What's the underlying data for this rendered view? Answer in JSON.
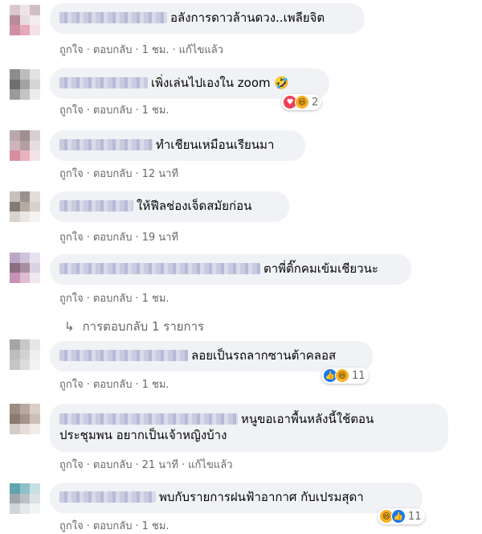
{
  "comments": [
    {
      "text": "อลังการดาวล้านดวง..เพลียจิต",
      "actions": {
        "like": "ถูกใจ",
        "reply": "ตอบกลับ",
        "time": "1 ชม.",
        "edited": "แก้ไขแล้ว"
      },
      "avatar_colors": [
        "#d9c9cf",
        "#eee4e8",
        "#cfbfc6",
        "#b88c99",
        "#e8dce1",
        "#f2ecef",
        "#cf8fa2",
        "#e6a9b9",
        "#f4e0e6"
      ]
    },
    {
      "text": "เพิ่งเล่นไปเองใน zoom 🤣",
      "actions": {
        "like": "ถูกใจ",
        "reply": "ตอบกลับ",
        "time": "1 ชม."
      },
      "reactions": {
        "icons": [
          "love-icon",
          "haha-icon"
        ],
        "count": "2"
      },
      "avatar_colors": [
        "#8d8d8d",
        "#bdbdbd",
        "#e2e2e2",
        "#6f6f6f",
        "#a2a2a2",
        "#d5d5d5",
        "#9a9a9a",
        "#c4c4c4",
        "#ececec"
      ]
    },
    {
      "text": "ทำเชียนเหมือนเรียนมา",
      "actions": {
        "like": "ถูกใจ",
        "reply": "ตอบกลับ",
        "time": "12 นาที"
      },
      "avatar_colors": [
        "#b9a7ab",
        "#a08e91",
        "#d6d0d3",
        "#cdb5bb",
        "#b49ea3",
        "#e6dde0",
        "#d58fa1",
        "#e8b2bf",
        "#f3e3e7"
      ]
    },
    {
      "text": "ให้ฟีลช่องเจ็ดสมัยก่อน",
      "actions": {
        "like": "ถูกใจ",
        "reply": "ตอบกลับ",
        "time": "19 นาที"
      },
      "avatar_colors": [
        "#c7c1bd",
        "#9c928c",
        "#e2ddd9",
        "#847a74",
        "#b5aba5",
        "#d8d1cc",
        "#d9d3cf",
        "#eae6e3",
        "#f5f2f0"
      ]
    },
    {
      "text": "ตาพี่ติ๊กคมเข้มเชียวนะ",
      "actions": {
        "like": "ถูกใจ",
        "reply": "ตอบกลับ",
        "time": "1 ชม."
      },
      "avatar_colors": [
        "#b9a8c8",
        "#cfc3dc",
        "#e8e2ef",
        "#8b6d7f",
        "#a78fa0",
        "#dad3e3",
        "#c790b4",
        "#e0bcd4",
        "#f2e6ef"
      ]
    },
    {
      "text": "ลอยเป็นรถลากซานต้าคลอส",
      "actions": {
        "like": "ถูกใจ",
        "reply": "ตอบกลับ",
        "time": "1 ชม."
      },
      "reactions": {
        "icons": [
          "like-icon",
          "haha-icon"
        ],
        "count": "11"
      },
      "avatar_colors": [
        "#a5a5a5",
        "#c8c8c8",
        "#e6e6e6",
        "#bdbdbd",
        "#d2d2d2",
        "#efefef",
        "#c6c6c6",
        "#dcdcdc",
        "#f3f3f3"
      ]
    },
    {
      "text_line1": "หนูขอเอาพื้นหลังนี้ใช้ตอน",
      "text_line2": "ประชุมพน อยากเป็นเจ้าหญิงบ้าง",
      "actions": {
        "like": "ถูกใจ",
        "reply": "ตอบกลับ",
        "time": "21 นาที",
        "edited": "แก้ไขแล้ว"
      },
      "avatar_colors": [
        "#9b8c84",
        "#b8aaa2",
        "#d9cec8",
        "#8a7a72",
        "#a4948c",
        "#cbbfb8",
        "#d6cbc5",
        "#e6ddd8",
        "#f1ebe8"
      ]
    },
    {
      "text": "พบกับรายการฝนฟ้าอากาศ กับเปรมสุดา",
      "actions": {
        "like": "ถูกใจ",
        "reply": "ตอบกลับ",
        "time": "1 ชม."
      },
      "reactions": {
        "icons": [
          "haha-icon",
          "like-icon"
        ],
        "count": "11"
      },
      "avatar_colors": [
        "#5fa4ae",
        "#8cc1c8",
        "#c7e0e3",
        "#9fa7ad",
        "#b9c1c6",
        "#dde2e5",
        "#cfd6da",
        "#e3e8ea",
        "#f2f5f6"
      ]
    }
  ],
  "view_replies": {
    "arrow": "↳",
    "label": "การตอบกลับ 1 รายการ"
  }
}
